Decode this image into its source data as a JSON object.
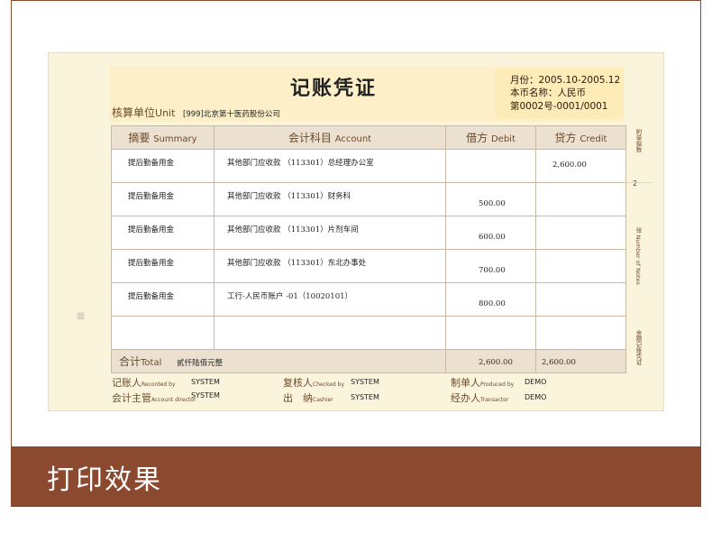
{
  "voucher": {
    "title": "记账凭证",
    "month": "月份：2005.10-2005.12",
    "currency": "本币名称：人民币",
    "number": "第0002号-0001/0001",
    "unit_label_cn": "核算单位",
    "unit_label_en": "Unit",
    "unit_value": "[999]北京第十医药股份公司"
  },
  "table": {
    "headers": [
      {
        "cn": "摘要",
        "en": "Summary"
      },
      {
        "cn": "会计科目",
        "en": "Account"
      },
      {
        "cn": "借方",
        "en": "Debit"
      },
      {
        "cn": "贷方",
        "en": "Credit"
      }
    ],
    "rows": [
      {
        "summary": "提后勤备用金",
        "account": "其他部门应收款  （113301）总经理办公室",
        "debit": "",
        "credit": "2,600.00"
      },
      {
        "summary": "提后勤备用金",
        "account": "其他部门应收款  （113301）财务科",
        "debit": "500.00",
        "credit": ""
      },
      {
        "summary": "提后勤备用金",
        "account": "其他部门应收款  （113301）片剂车间",
        "debit": "600.00",
        "credit": ""
      },
      {
        "summary": "提后勤备用金",
        "account": "其他部门应收款  （113301）东北办事处",
        "debit": "700.00",
        "credit": ""
      },
      {
        "summary": "提后勤备用金",
        "account": "工行-人民币账户 -01（10020101）",
        "debit": "800.00",
        "credit": ""
      },
      {
        "summary": "",
        "account": "",
        "debit": "",
        "credit": ""
      }
    ],
    "total": {
      "label_cn": "合计",
      "label_en": "Total",
      "words": "贰仟陆佰元整",
      "debit": "2,600.00",
      "credit": "2,600.00"
    }
  },
  "right_side": {
    "attachments_label": "附单据数",
    "attachments_value": "2",
    "sheets_label": "张 Number of Notes",
    "bottom_label": "金额记账凭证"
  },
  "signatures": [
    {
      "cn": "记账人",
      "en": "Recorded by",
      "value": "SYSTEM"
    },
    {
      "cn": "复核人",
      "en": "Checked by",
      "value": "SYSTEM"
    },
    {
      "cn": "制单人",
      "en": "Produced by",
      "value": "DEMO"
    },
    {
      "cn": "会计主管",
      "en": "Account director",
      "value": "SYSTEM"
    },
    {
      "cn": "出　纳",
      "en": "Cashier",
      "value": "SYSTEM"
    },
    {
      "cn": "经办人",
      "en": "Transactor",
      "value": "DEMO"
    }
  ],
  "banner": {
    "text": "打印效果"
  },
  "colors": {
    "banner": "#8b4a2f",
    "paper": "#fbf4dd",
    "header_cell": "#ece0d1",
    "label": "#6b4a2a"
  }
}
